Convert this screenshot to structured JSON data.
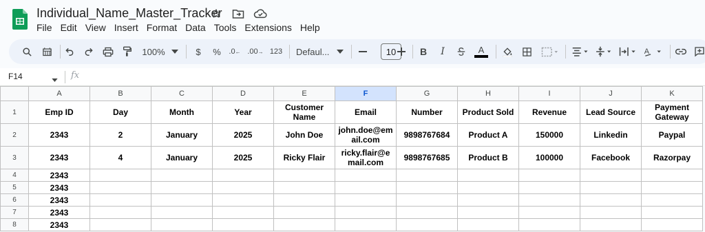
{
  "app": {
    "title": "Individual_Name_Master_Tracker",
    "brand_color": "#0f9d58"
  },
  "menu": [
    "File",
    "Edit",
    "View",
    "Insert",
    "Format",
    "Data",
    "Tools",
    "Extensions",
    "Help"
  ],
  "toolbar": {
    "zoom": "100%",
    "currency": "$",
    "percent": "%",
    "decrease_decimal": ".0",
    "increase_decimal": ".00",
    "number_format": "123",
    "font": "Defaul...",
    "font_size": "10",
    "bold": "B",
    "italic": "I",
    "text_color": "A",
    "text_color_swatch": "#000000"
  },
  "formula_bar": {
    "cell_ref": "F14",
    "fx": "fx"
  },
  "sheet": {
    "selected_column": "F",
    "columns": [
      "A",
      "B",
      "C",
      "D",
      "E",
      "F",
      "G",
      "H",
      "I",
      "J",
      "K"
    ],
    "row_numbers": [
      "1",
      "2",
      "3",
      "4",
      "5",
      "6",
      "7",
      "8"
    ],
    "headers": [
      "Emp ID",
      "Day",
      "Month",
      "Year",
      "Customer Name",
      "Email",
      "Number",
      "Product Sold",
      "Revenue",
      "Lead Source",
      "Payment Gateway"
    ],
    "rows": [
      [
        "2343",
        "2",
        "January",
        "2025",
        "John Doe",
        "john.doe@email.com",
        "9898767684",
        "Product A",
        "150000",
        "Linkedin",
        "Paypal"
      ],
      [
        "2343",
        "4",
        "January",
        "2025",
        "Ricky Flair",
        "ricky.flair@email.com",
        "9898767685",
        "Product B",
        "100000",
        "Facebook",
        "Razorpay"
      ],
      [
        "2343",
        "",
        "",
        "",
        "",
        "",
        "",
        "",
        "",
        "",
        ""
      ],
      [
        "2343",
        "",
        "",
        "",
        "",
        "",
        "",
        "",
        "",
        "",
        ""
      ],
      [
        "2343",
        "",
        "",
        "",
        "",
        "",
        "",
        "",
        "",
        "",
        ""
      ],
      [
        "2343",
        "",
        "",
        "",
        "",
        "",
        "",
        "",
        "",
        "",
        ""
      ],
      [
        "2343",
        "",
        "",
        "",
        "",
        "",
        "",
        "",
        "",
        "",
        ""
      ]
    ]
  }
}
